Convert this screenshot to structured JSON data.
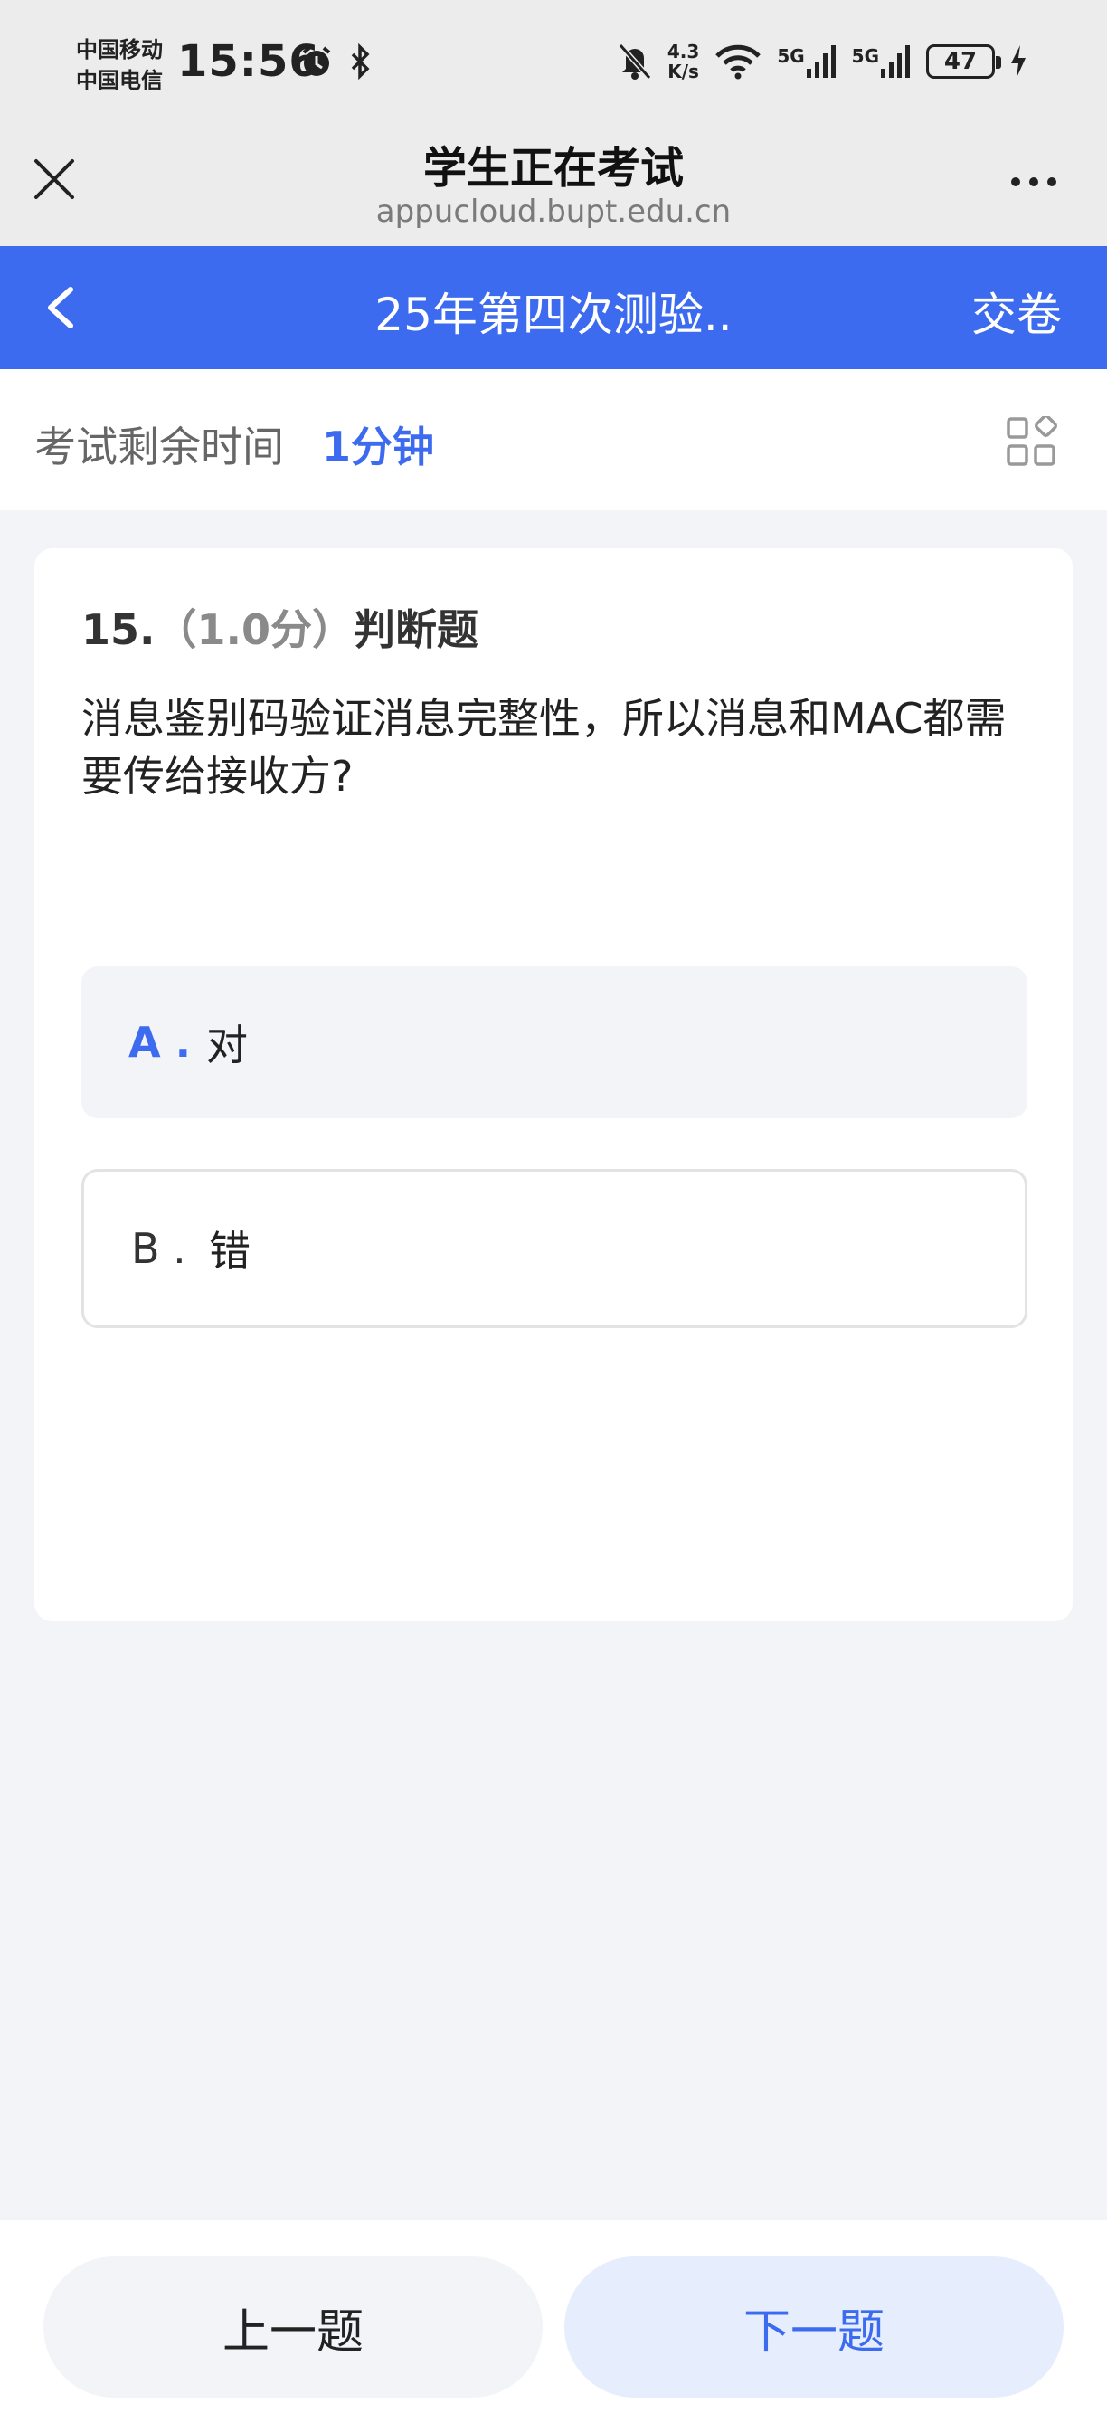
{
  "status_bar": {
    "carrier_1": "中国移动",
    "carrier_2": "中国电信",
    "time": "15:56",
    "net_speed_value": "4.3",
    "net_speed_unit": "K/s",
    "signal_1_label": "5G",
    "signal_2_label": "5G",
    "battery": "47",
    "icons": [
      "alarm-icon",
      "bluetooth-icon",
      "mute-bell-icon",
      "wifi-icon",
      "signal-icon",
      "signal-icon",
      "battery-icon",
      "charging-icon"
    ]
  },
  "browser": {
    "title": "学生正在考试",
    "url": "appucloud.bupt.edu.cn"
  },
  "header": {
    "title": "25年第四次测验..",
    "submit_label": "交卷",
    "accent_color": "#3d6bf0"
  },
  "timer": {
    "label": "考试剩余时间",
    "value": "1分钟"
  },
  "question": {
    "number": "15.",
    "score": "（1.0分）",
    "type": "判断题",
    "text": "消息鉴别码验证消息完整性，所以消息和MAC都需要传给接收方?",
    "options": [
      {
        "letter": "A .",
        "text": "对",
        "selected": true
      },
      {
        "letter": "B .",
        "text": "错",
        "selected": false
      }
    ]
  },
  "footer": {
    "prev_label": "上一题",
    "next_label": "下一题"
  }
}
